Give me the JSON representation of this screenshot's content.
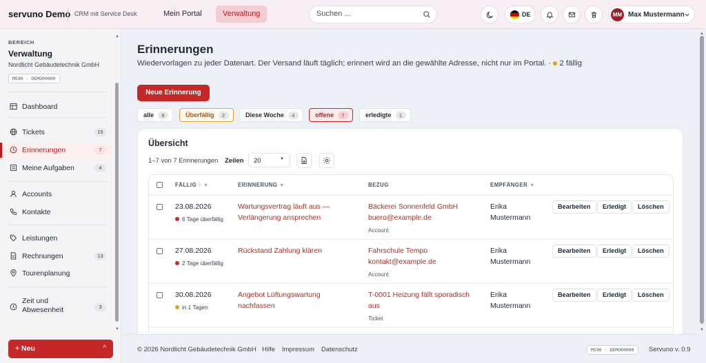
{
  "header": {
    "brand": "servuno Demo",
    "subtitle": "CRM mit Service Desk",
    "nav": [
      {
        "label": "Mein Portal"
      },
      {
        "label": "Verwaltung"
      }
    ],
    "search_placeholder": "Suchen ...",
    "language": "DE",
    "user_initials": "MM",
    "user_name": "Max Mustermann"
  },
  "sidebar": {
    "section_label": "BEREICH",
    "title": "Verwaltung",
    "company": "Nordlicht Gebäudetechnik GmbH",
    "tag": "MS96 · DEMO00000",
    "items": [
      {
        "label": "Dashboard",
        "count": ""
      },
      {
        "label": "Tickets",
        "count": "15"
      },
      {
        "label": "Erinnerungen",
        "count": "7"
      },
      {
        "label": "Meine Aufgaben",
        "count": "4"
      },
      {
        "label": "Accounts",
        "count": ""
      },
      {
        "label": "Kontakte",
        "count": ""
      },
      {
        "label": "Leistungen",
        "count": ""
      },
      {
        "label": "Rechnungen",
        "count": "13"
      },
      {
        "label": "Tourenplanung",
        "count": ""
      },
      {
        "label": "Zeit und",
        "label2": "Abwesenheit",
        "count": "3"
      }
    ],
    "new_button": "+ Neu",
    "new_button_chevron": "^"
  },
  "page": {
    "title": "Erinnerungen",
    "subtitle": "Wiedervorlagen zu jeder Datenart. Der Versand läuft täglich; erinnert wird an die gewählte Adresse, nicht nur im Portal. ·",
    "due_summary": "2 fällig",
    "primary_button": "Neue Erinnerung",
    "filters": [
      {
        "label": "alle",
        "count": "8"
      },
      {
        "label": "Überfällig",
        "count": "2"
      },
      {
        "label": "Diese Woche",
        "count": "4"
      },
      {
        "label": "offene",
        "count": "7"
      },
      {
        "label": "erledigte",
        "count": "1"
      }
    ]
  },
  "card": {
    "title": "Übersicht",
    "range_text": "1–7 von 7 Erinnerungen",
    "rows_label": "Zeilen",
    "rows_value": "20",
    "columns": {
      "due": "FÄLLIG",
      "reminder": "ERINNERUNG",
      "ref": "BEZUG",
      "recipient": "EMPFÄNGER"
    },
    "actions": {
      "edit": "Bearbeiten",
      "done": "Erledigt",
      "delete": "Löschen"
    },
    "rows": [
      {
        "date": "23.08.2026",
        "due": "6 Tage überfällig",
        "title": "Wartungsvertrag läuft aus — Verlängerung ansprechen",
        "ref": "Bäckerei Sonnenfeld GmbH buero@example.de",
        "ref_type": "Account",
        "recipient": "Erika Mustermann"
      },
      {
        "date": "27.08.2026",
        "due": "2 Tage überfällig",
        "title": "Rückstand Zahlung klären",
        "ref": "Fahrschule Tempo kontakt@example.de",
        "ref_type": "Account",
        "recipient": "Erika Mustermann"
      },
      {
        "date": "30.08.2026",
        "due": "in 1 Tagen",
        "title": "Angebot Lüftungswartung nachfassen",
        "ref": "T-0001 Heizung fällt sporadisch aus",
        "ref_type": "Ticket",
        "recipient": "Erika Mustermann"
      }
    ]
  },
  "footer": {
    "copyright": "© 2026 Nordlicht Gebäudetechnik GmbH",
    "links": [
      "Hilfe",
      "Impressum",
      "Datenschutz"
    ],
    "tag": "MS96 · DEMO00000",
    "version": "Servuno v. 0.9"
  },
  "colors": {
    "accent": "#c62828",
    "overdue": "#c62828",
    "upcoming": "#e0a21b"
  }
}
